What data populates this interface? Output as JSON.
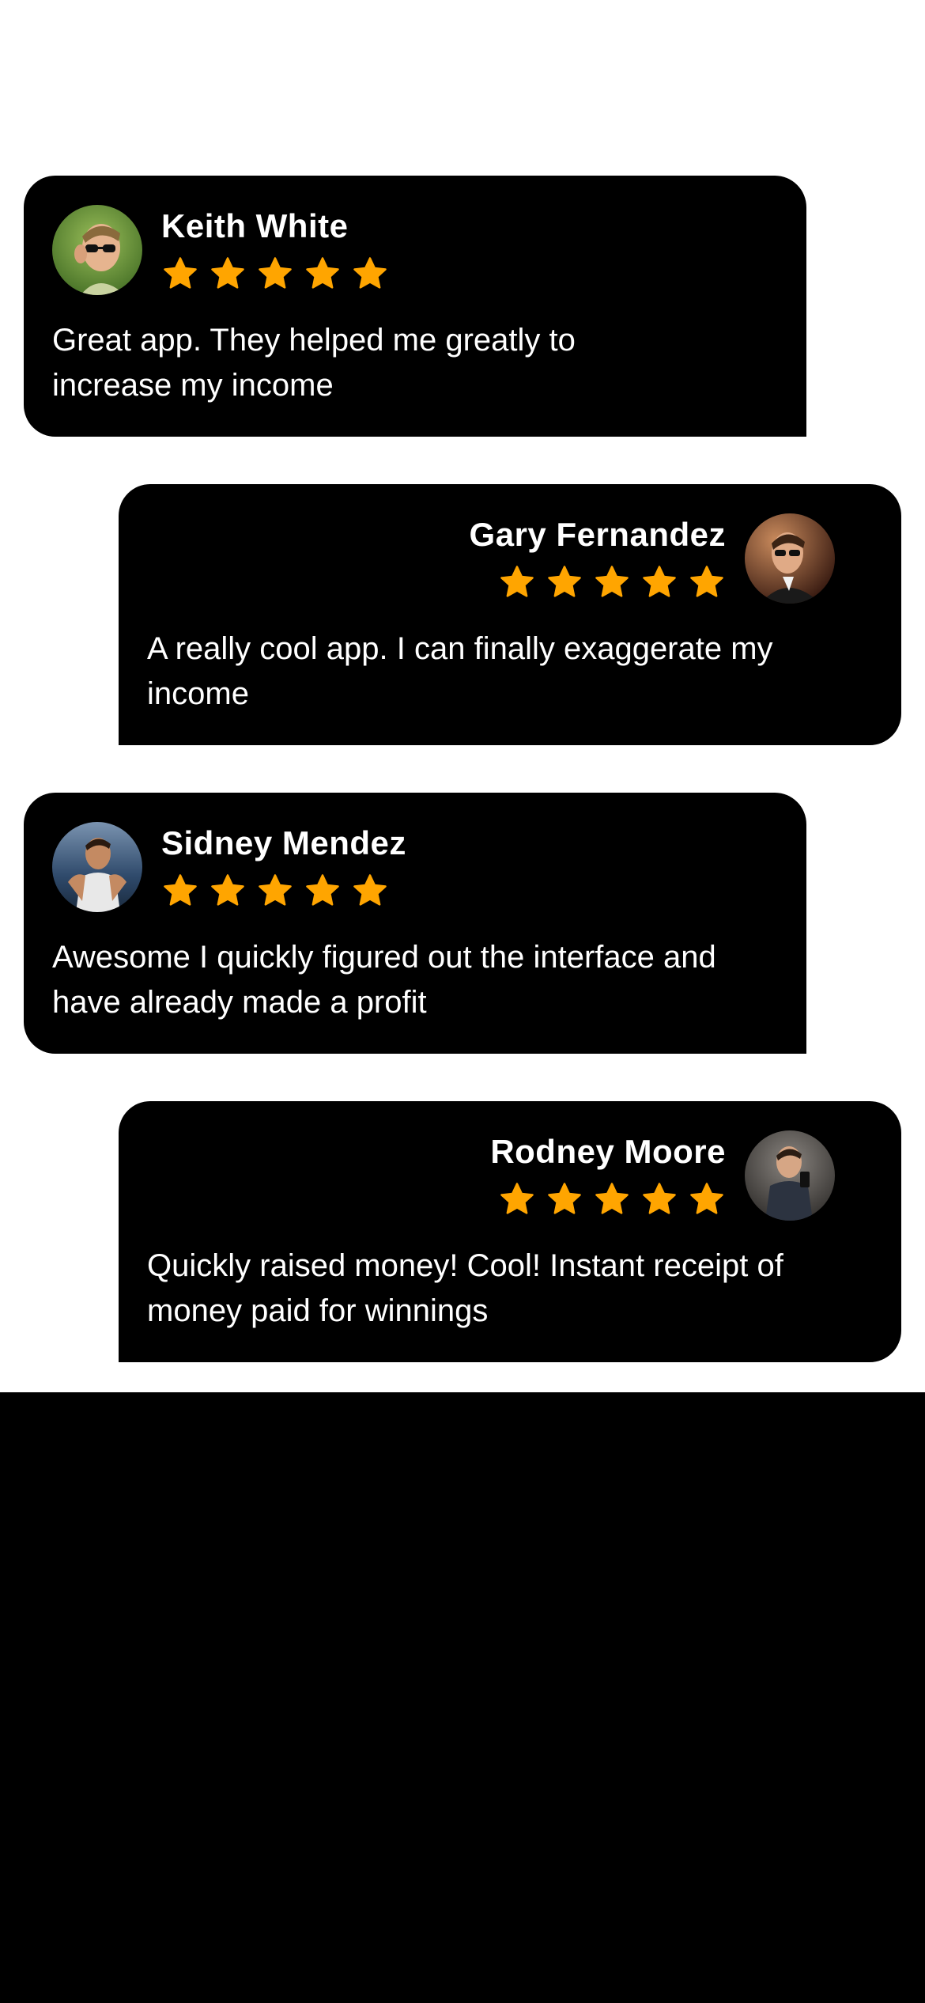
{
  "colors": {
    "card_bg": "#000000",
    "page_bg": "#ffffff",
    "text": "#ffffff",
    "star": "#FFA500"
  },
  "reviews": [
    {
      "name": "Keith White",
      "rating": 5,
      "text": "Great app. They helped me greatly to increase my income",
      "avatar_icon": "avatar-photo"
    },
    {
      "name": "Gary Fernandez",
      "rating": 5,
      "text": "A really cool app. I can finally exaggerate my income",
      "avatar_icon": "avatar-photo"
    },
    {
      "name": "Sidney Mendez",
      "rating": 5,
      "text": "Awesome I quickly figured out the interface and have already made a profit",
      "avatar_icon": "avatar-photo"
    },
    {
      "name": "Rodney Moore",
      "rating": 5,
      "text": "Quickly raised money! Cool! Instant receipt of money paid for winnings",
      "avatar_icon": "avatar-photo"
    }
  ]
}
